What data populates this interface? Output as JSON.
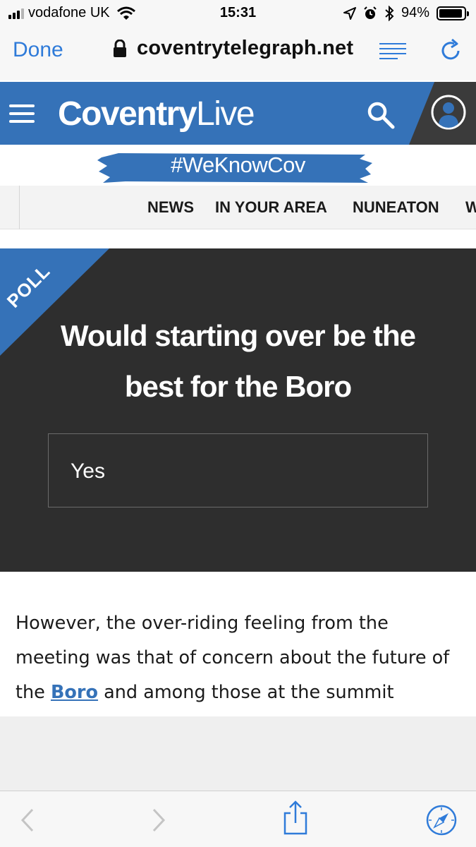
{
  "status_bar": {
    "carrier": "vodafone UK",
    "time": "15:31",
    "battery_text": "94%",
    "battery_level": 0.94,
    "icons": [
      "signal-icon",
      "wifi-icon",
      "location-icon",
      "alarm-icon",
      "bluetooth-icon",
      "battery-icon"
    ]
  },
  "browser": {
    "done_label": "Done",
    "url": "coventrytelegraph.net",
    "icons": [
      "lock-icon",
      "reader-icon",
      "reload-icon"
    ],
    "accent_color": "#2f7bd9"
  },
  "site_header": {
    "logo_bold": "Coventry",
    "logo_light": "Live",
    "brand_color": "#3572b8",
    "icons": [
      "menu-icon",
      "search-icon",
      "account-icon"
    ]
  },
  "hashtag": "#WeKnowCov",
  "section_nav": {
    "items": [
      "NEWS",
      "IN YOUR AREA",
      "NUNEATON",
      "W"
    ]
  },
  "poll": {
    "label": "POLL",
    "question": "Would starting over be the best for the Boro",
    "options": [
      "Yes"
    ]
  },
  "article": {
    "text_before_link": "However, the over-riding feeling from the meeting was that of concern about the future of the ",
    "link_text": "Boro",
    "text_after_link": " and among those at the summit"
  },
  "bottom_toolbar": {
    "icons": [
      "back-icon",
      "forward-icon",
      "share-icon",
      "compass-icon"
    ]
  }
}
